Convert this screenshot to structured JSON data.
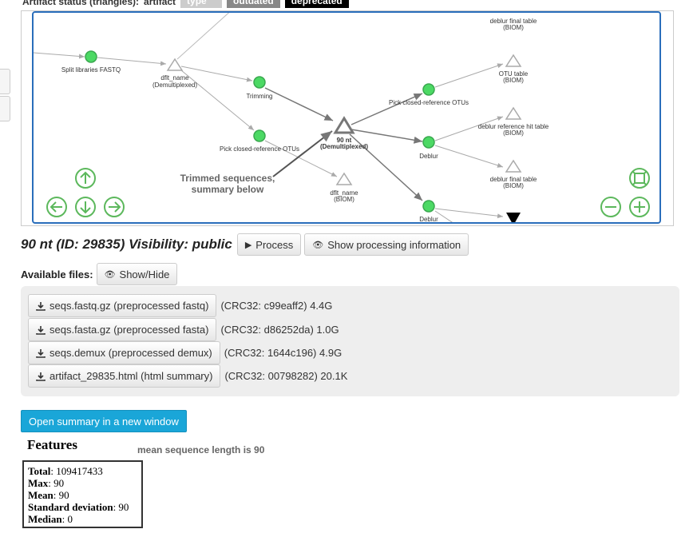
{
  "legend": {
    "label": "Artifact status (triangles):",
    "entries": [
      "artifact",
      "type",
      "outdated",
      "deprecated"
    ]
  },
  "network": {
    "nodes": {
      "split_libraries": "Split libraries FASTQ",
      "dflt_demux": [
        "dflt_name",
        "(Demultiplexed)"
      ],
      "trimming": "Trimming",
      "pick_closed_left": "Pick closed-reference OTUs",
      "nt90": [
        "90 nt",
        "(Demultiplexed)"
      ],
      "dflt_biom": [
        "dflt_name",
        "(BIOM)"
      ],
      "pick_closed_right": "Pick closed-reference OTUs",
      "deblur_mid": "Deblur",
      "deblur_bottom": "Deblur",
      "otu_table": [
        "OTU table",
        "(BIOM)"
      ],
      "deblur_ref_hit": [
        "deblur reference hit table",
        "(BIOM)"
      ],
      "deblur_final_mid": [
        "deblur final table",
        "(BIOM)"
      ],
      "deblur_final_top": [
        "deblur final table",
        "(BIOM)"
      ]
    },
    "annotation": [
      "Trimmed sequences,",
      "summary below"
    ],
    "controls": [
      "zoom-up-icon",
      "pan-left-icon",
      "pan-down-icon",
      "pan-right-icon",
      "fit-icon",
      "zoom-out-icon",
      "zoom-in-icon"
    ],
    "colors": {
      "process_node": "#4cd964",
      "frame": "#2a6ebb",
      "control": "#5cb85c"
    }
  },
  "artifact": {
    "title": "90 nt (ID: 29835) Visibility: public",
    "process_label": "Process",
    "show_info_label": "Show processing information"
  },
  "files": {
    "label": "Available files:",
    "toggle_label": "Show/Hide",
    "items": [
      {
        "name": "seqs.fastq.gz (preprocessed fastq)",
        "meta": "(CRC32: c99eaff2) 4.4G"
      },
      {
        "name": "seqs.fasta.gz (preprocessed fasta)",
        "meta": "(CRC32: d86252da) 1.0G"
      },
      {
        "name": "seqs.demux (preprocessed demux)",
        "meta": "(CRC32: 1644c196) 4.9G"
      },
      {
        "name": "artifact_29835.html (html summary)",
        "meta": "(CRC32: 00798282) 20.1K"
      }
    ]
  },
  "summary": {
    "open_button": "Open summary in a new window",
    "features_title": "Features",
    "note": "mean sequence length is 90",
    "stats": [
      {
        "label": "Total",
        "value": ": 109417433"
      },
      {
        "label": "Max",
        "value": ": 90"
      },
      {
        "label": "Mean",
        "value": ": 90"
      },
      {
        "label": "Standard deviation",
        "value": ": 90"
      },
      {
        "label": "Median",
        "value": ": 0"
      }
    ]
  }
}
